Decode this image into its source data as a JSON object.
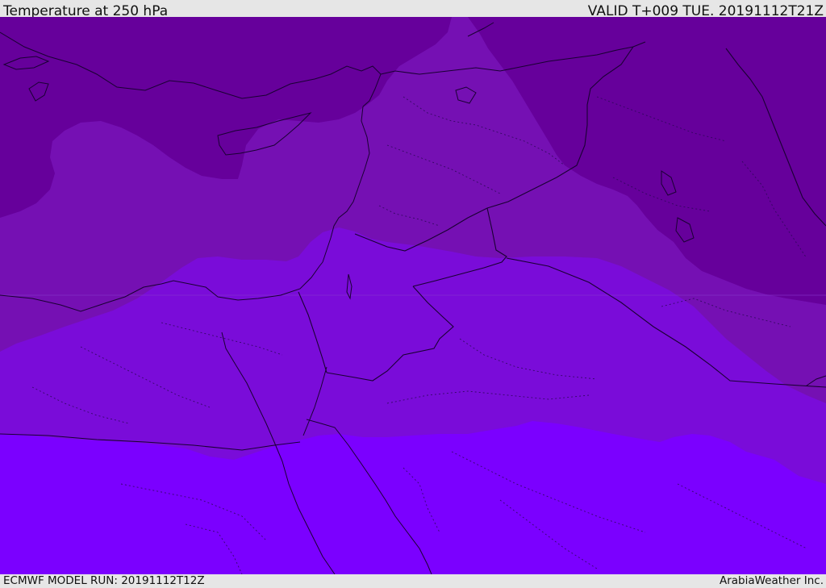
{
  "header": {
    "title": "Temperature at 250 hPa",
    "valid": "VALID T+009 TUE. 20191112T21Z"
  },
  "footer": {
    "model_run": "ECMWF MODEL RUN: 20191112T12Z",
    "credit": "ArabiaWeather Inc."
  },
  "colors": {
    "band_darkest": "#66009b",
    "band_dark": "#7510b3",
    "band_mid": "#7a0cd9",
    "band_light": "#7b00ff",
    "border_line": "#1a0033",
    "frame_bg": "#e6e6e6"
  },
  "map": {
    "region": "Eastern Mediterranean, Levant, Egypt and Arabia",
    "layers": [
      "temperature-fill",
      "coastlines",
      "country-borders",
      "province-borders"
    ]
  }
}
